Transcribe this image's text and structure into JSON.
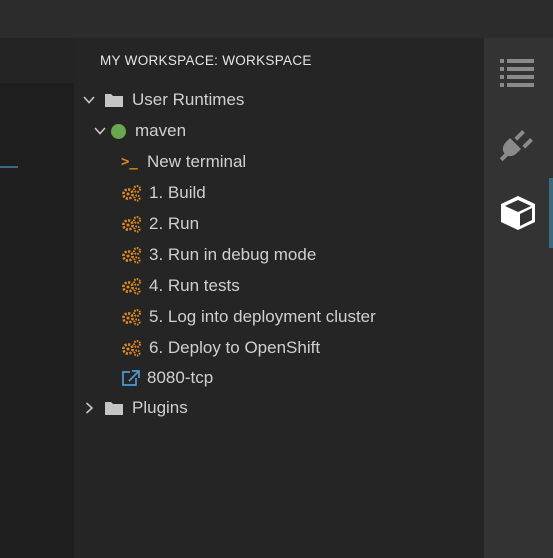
{
  "panel": {
    "title": "MY WORKSPACE: WORKSPACE"
  },
  "tree": {
    "user_runtimes": {
      "label": "User Runtimes",
      "expanded": true
    },
    "maven": {
      "label": "maven",
      "status_color": "#6aa84f",
      "expanded": true
    },
    "new_terminal": {
      "label": "New terminal",
      "icon": "terminal-icon"
    },
    "commands": [
      {
        "label": "1. Build",
        "icon": "gears-icon"
      },
      {
        "label": "2. Run",
        "icon": "gears-icon"
      },
      {
        "label": "3. Run in debug mode",
        "icon": "gears-icon"
      },
      {
        "label": "4. Run tests",
        "icon": "gears-icon"
      },
      {
        "label": "5. Log into deployment cluster",
        "icon": "gears-icon"
      },
      {
        "label": "6. Deploy to OpenShift",
        "icon": "gears-icon"
      }
    ],
    "endpoint": {
      "label": "8080-tcp",
      "icon": "external-link-icon"
    },
    "plugins": {
      "label": "Plugins",
      "expanded": false
    }
  },
  "sidebar_icons": [
    "outline-list-icon",
    "plug-icon",
    "cube-icon"
  ],
  "colors": {
    "accent": "#e08a1e",
    "link": "#4a9bd6",
    "active": "#3b6a80"
  }
}
